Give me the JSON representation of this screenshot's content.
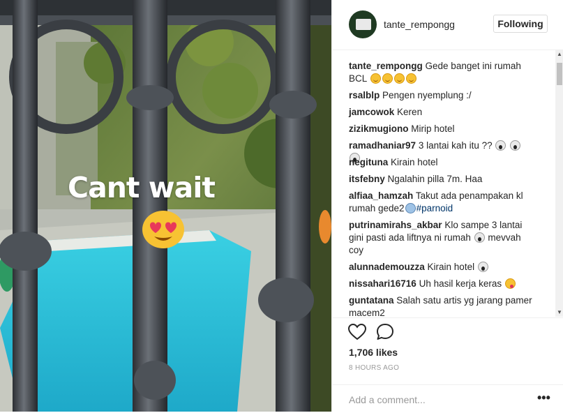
{
  "post": {
    "overlay_text": "Cant wait",
    "author": "tante_rempongg",
    "follow_label": "Following",
    "likes": "1,706 likes",
    "timestamp": "8 HOURS AGO",
    "comment_placeholder": "Add a comment...",
    "more_label": "•••"
  },
  "comments": [
    {
      "user": "tante_rempongg",
      "text": "Gede banget ini rumah BCL",
      "emoji": [
        "smile",
        "smile",
        "smile",
        "smile"
      ]
    },
    {
      "user": "rsalblp",
      "text": "Pengen nyemplung :/",
      "emoji": []
    },
    {
      "user": "jamcowok",
      "text": "Keren",
      "emoji": []
    },
    {
      "user": "zizikmugiono",
      "text": "Mirip hotel",
      "emoji": []
    },
    {
      "user": "ramadhaniar97",
      "text": "3 lantai kah itu ??",
      "emoji": [
        "scream",
        "scream",
        "scream"
      ]
    },
    {
      "user": "negituna",
      "text": "Kirain hotel",
      "emoji": []
    },
    {
      "user": "itsfebny",
      "text": "Ngalahin pilla 7m. Haa",
      "emoji": []
    },
    {
      "user": "alfiaa_hamzah",
      "text": "Takut ada penampakan kl rumah gede2",
      "emoji": [
        "fear"
      ],
      "tag": "#parnoid"
    },
    {
      "user": "putrinamirahs_akbar",
      "text": "Klo sampe 3 lantai gini pasti ada liftnya ni rumah",
      "emoji": [
        "scream"
      ],
      "after": "mevvah coy"
    },
    {
      "user": "alunnademouzza",
      "text": "Kirain hotel",
      "emoji": [
        "scream"
      ]
    },
    {
      "user": "nissahari16716",
      "text": "Uh hasil kerja keras",
      "emoji": [
        "tongue"
      ]
    },
    {
      "user": "guntatana",
      "text": "Salah satu artis yg jarang pamer macem2",
      "emoji": []
    }
  ],
  "icons": {
    "heart": "heart-icon",
    "comment": "comment-bubble-icon",
    "more": "more-options-icon"
  },
  "colors": {
    "tag": "#003569",
    "pool": "#2fc3d9",
    "border": "#efefef"
  }
}
